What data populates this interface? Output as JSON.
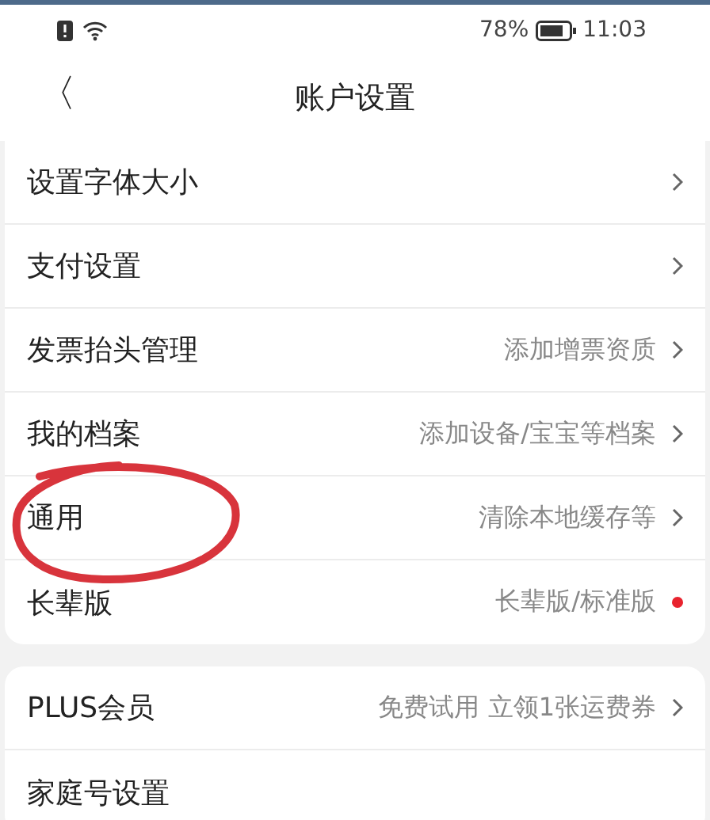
{
  "status_bar": {
    "battery": "78%",
    "time": "11:03"
  },
  "header": {
    "back": "〈",
    "title": "账户设置"
  },
  "sections": [
    {
      "rows": [
        {
          "label": "设置字体大小",
          "kind": "link"
        },
        {
          "label": "支付设置",
          "kind": "link"
        },
        {
          "label": "发票抬头管理",
          "value": "添加增票资质",
          "kind": "link"
        },
        {
          "label": "我的档案",
          "value": "添加设备/宝宝等档案",
          "kind": "link"
        },
        {
          "label": "通用",
          "value": "清除本地缓存等",
          "kind": "link"
        },
        {
          "label": "长辈版",
          "value": "长辈版/标准版",
          "kind": "dot"
        }
      ]
    },
    {
      "rows": [
        {
          "label": "PLUS会员",
          "value": "免费试用 立领1张运费券",
          "kind": "link"
        },
        {
          "label": "家庭号设置",
          "kind": "plain"
        }
      ]
    }
  ],
  "annotation": {
    "kind": "circle"
  }
}
